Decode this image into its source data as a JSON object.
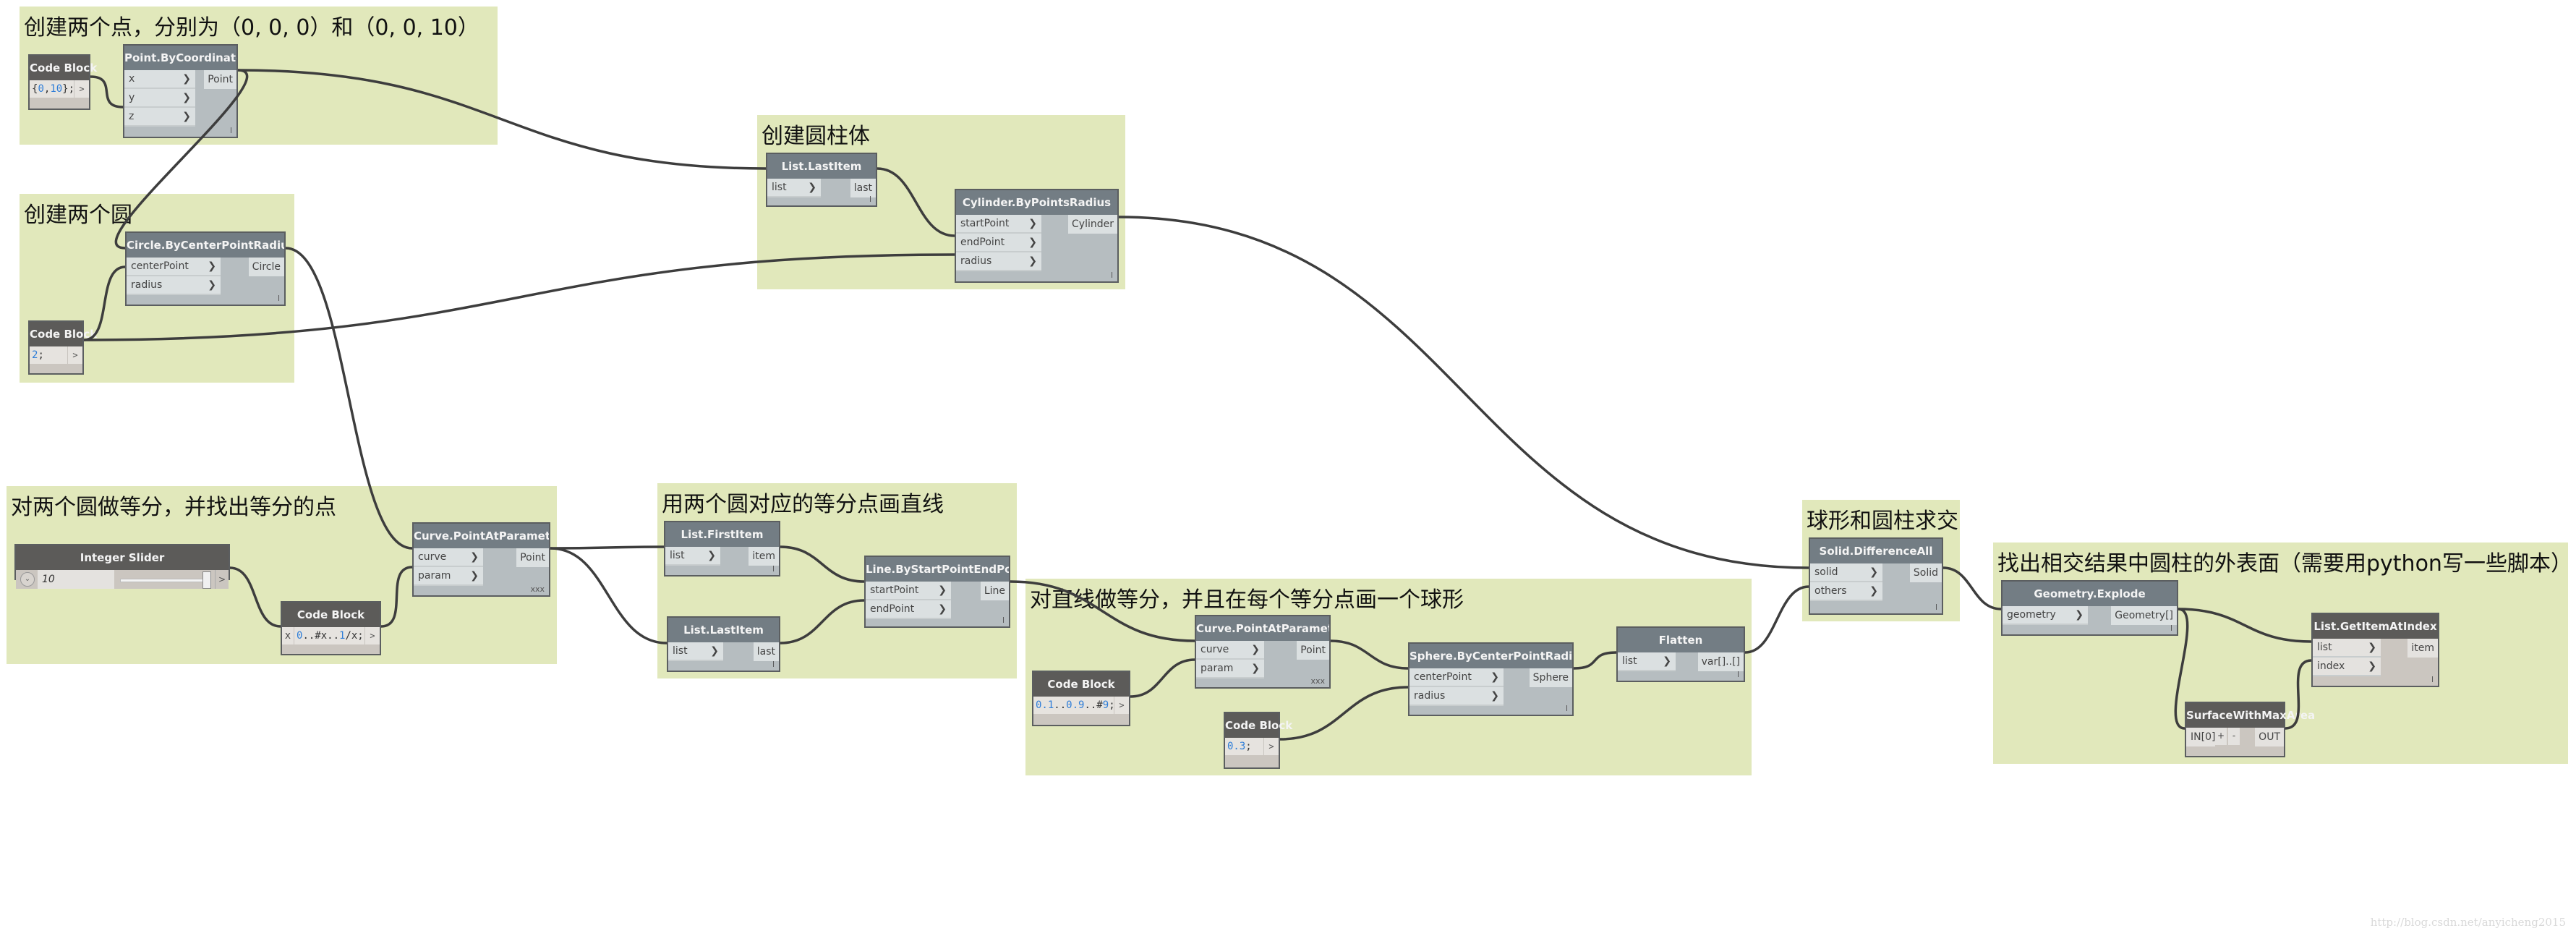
{
  "groups": [
    {
      "id": "g1",
      "title": "创建两个点，分别为（0, 0, 0）和（0, 0, 10）"
    },
    {
      "id": "g2",
      "title": "创建两个圆"
    },
    {
      "id": "g3",
      "title": "创建圆柱体"
    },
    {
      "id": "g4",
      "title": "对两个圆做等分，并找出等分的点"
    },
    {
      "id": "g5",
      "title": "用两个圆对应的等分点画直线"
    },
    {
      "id": "g6",
      "title": "对直线做等分，并且在每个等分点画一个球形"
    },
    {
      "id": "g7",
      "title": "球形和圆柱求交"
    },
    {
      "id": "g8",
      "title": "找出相交结果中圆柱的外表面（需要用python写一些脚本）"
    }
  ],
  "nodes": {
    "cb1": {
      "title": "Code Block",
      "code": [
        {
          "t": "{"
        },
        {
          "t": "0",
          "n": true
        },
        {
          "t": ","
        },
        {
          "t": "10",
          "n": true
        },
        {
          "t": "};"
        }
      ],
      "out": ">"
    },
    "pbc": {
      "title": "Point.ByCoordinates",
      "inputs": [
        "x",
        "y",
        "z"
      ],
      "output": "Point",
      "lacing": "l"
    },
    "circle": {
      "title": "Circle.ByCenterPointRadius",
      "inputs": [
        "centerPoint",
        "radius"
      ],
      "output": "Circle",
      "lacing": "l"
    },
    "cb2": {
      "title": "Code Block",
      "code": [
        {
          "t": "2",
          "n": true
        },
        {
          "t": ";"
        }
      ],
      "out": ">"
    },
    "last1": {
      "title": "List.LastItem",
      "inputs": [
        "list"
      ],
      "output": "last",
      "lacing": "l"
    },
    "cylinder": {
      "title": "Cylinder.ByPointsRadius",
      "inputs": [
        "startPoint",
        "endPoint",
        "radius"
      ],
      "output": "Cylinder",
      "lacing": "l"
    },
    "slider": {
      "title": "Integer Slider",
      "value": "10",
      "value_fraction": 1.0,
      "out": ">"
    },
    "cb3": {
      "title": "Code Block",
      "input": "x",
      "code": [
        {
          "t": "0",
          "n": true
        },
        {
          "t": "..#x.."
        },
        {
          "t": "1",
          "n": true
        },
        {
          "t": "/x;"
        }
      ],
      "out": ">"
    },
    "cpap1": {
      "title": "Curve.PointAtParameter",
      "inputs": [
        "curve",
        "param"
      ],
      "output": "Point",
      "lacing": "xxx"
    },
    "first": {
      "title": "List.FirstItem",
      "inputs": [
        "list"
      ],
      "output": "item",
      "lacing": "l"
    },
    "last2": {
      "title": "List.LastItem",
      "inputs": [
        "list"
      ],
      "output": "last",
      "lacing": "l"
    },
    "line": {
      "title": "Line.ByStartPointEndPoint",
      "inputs": [
        "startPoint",
        "endPoint"
      ],
      "output": "Line",
      "lacing": "l"
    },
    "cpap2": {
      "title": "Curve.PointAtParameter",
      "inputs": [
        "curve",
        "param"
      ],
      "output": "Point",
      "lacing": "xxx"
    },
    "cb4": {
      "title": "Code Block",
      "code": [
        {
          "t": "0.1",
          "n": true
        },
        {
          "t": ".."
        },
        {
          "t": "0.9",
          "n": true
        },
        {
          "t": "..#"
        },
        {
          "t": "9",
          "n": true
        },
        {
          "t": ";"
        }
      ],
      "out": ">"
    },
    "cb5": {
      "title": "Code Block",
      "code": [
        {
          "t": "0.3",
          "n": true
        },
        {
          "t": ";"
        }
      ],
      "out": ">"
    },
    "sphere": {
      "title": "Sphere.ByCenterPointRadius",
      "inputs": [
        "centerPoint",
        "radius"
      ],
      "output": "Sphere",
      "lacing": "l"
    },
    "flatten": {
      "title": "Flatten",
      "inputs": [
        "list"
      ],
      "output": "var[]..[]",
      "lacing": "l"
    },
    "diff": {
      "title": "Solid.DifferenceAll",
      "inputs": [
        "solid",
        "others"
      ],
      "output": "Solid",
      "lacing": "l"
    },
    "explode": {
      "title": "Geometry.Explode",
      "inputs": [
        "geometry"
      ],
      "output": "Geometry[]",
      "lacing": "l"
    },
    "getitem": {
      "title": "List.GetItemAtIndex",
      "inputs": [
        "list",
        "index"
      ],
      "output": "item",
      "lacing": "l"
    },
    "swma": {
      "title": "SurfaceWithMaxArea",
      "input": "IN[0]",
      "add": "+",
      "remove": "-",
      "output": "OUT"
    }
  },
  "port_chevron": "❯",
  "watermark": "http://blog.csdn.net/anyicheng2015"
}
